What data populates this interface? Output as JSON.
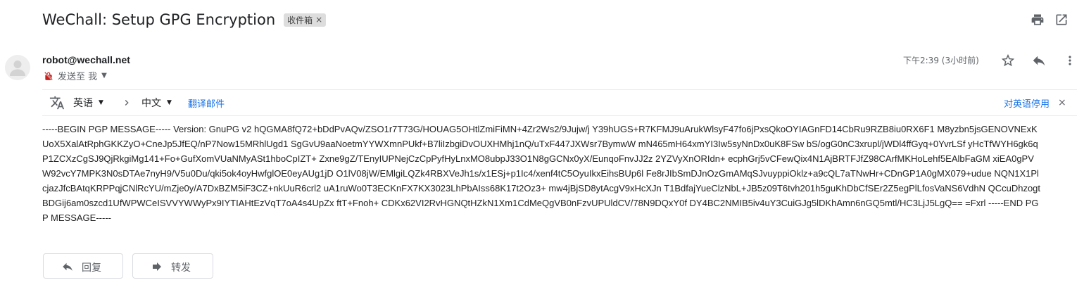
{
  "email": {
    "subject": "WeChall: Setup GPG Encryption",
    "label": "收件箱",
    "label_remove": "×",
    "sender": "robot@wechall.net",
    "to_text": "发送至 我",
    "timestamp": "下午2:39 (3小时前)",
    "body": "-----BEGIN PGP MESSAGE----- Version: GnuPG v2 hQGMA8fQ72+bDdPvAQv/ZSO1r7T73G/HOUAG5OHtlZmiFiMN+4Zr2Ws2/9Jujw/j Y39hUGS+R7KFMJ9uArukWlsyF47fo6jPxsQkoOYIAGnFD14CbRu9RZB8iu0RX6F1 M8yzbn5jsGENOVNExKUoX5XalAtRphGKKZyO+CneJp5JfEQ/nP7Now15MRhlUgd1 SgGvU9aaNoetmYYWXmnPUkf+B7liIzbgiDvOUXHMhj1nQ/uTxF447JXWsr7BymwW mN465mH64xmYI3Iw5syNnDx0uK8FSw bS/ogG0nC3xrupl/jWDl4ffGyq+0YvrLSf yHcTfWYH6gk6qP1ZCXzCgSJ9QjRkgiMg141+Fo+GufXomVUaNMyASt1hboCpIZT+ Zxne9gZ/TEnyIUPNejCzCpPyfHyLnxMO8ubpJ33O1N8gGCNx0yX/EunqoFnvJJ2z 2YZVyXnORIdn+ ecphGrj5vCFewQix4N1AjBRTFJfZ98CArfMKHoLehf5EAlbFaGM xiEA0gPVW92vcY7MPK3N0sDTAe7nyH9/V5u0Du/qki5ok4oyHwfglOE0eyAUg1jD O1lV08jW/EMlgiLQZk4RBXVeJh1s/x1ESj+p1Ic4/xenf4tC5OyuIkxEihsBUp6l Fe8rJIbSmDJnOzGmAMqSJvuyppiOklz+a9cQL7aTNwHr+CDnGP1A0gMX079+udue NQN1X1PlcjazJfcBAtqKRPPqjCNlRcYU/mZje0y/A7DxBZM5iF3CZ+nkUuR6crl2 uA1ruWo0T3ECKnFX7KX3023LhPbAIss68K17t2Oz3+ mw4jBjSD8ytAcgV9xHcXJn T1BdfajYueClzNbL+JB5z09T6tvh201h5guKhDbCfSEr2Z5egPlLfosVaNS6VdhN QCcuDhzogtBDGij6am0szcd1UfWPWCeISVVYWWyPx9IYTIAHtEzVqT7oA4s4UpZx ftT+Fnoh+ CDKx62VI2RvHGNQtHZkN1Xm1CdMeQgVB0nFzvUPUldCV/78N9DQxY0f DY4BC2NMIB5iv4uY3CuiGJg5lDKhAmn6nGQ5mtl/HC3LjJ5LgQ== =Fxrl -----END PGP MESSAGE-----"
  },
  "translate": {
    "source_lang": "英语",
    "target_lang": "中文",
    "translate_link": "翻译邮件",
    "stop_link": "对英语停用",
    "close": "×"
  },
  "actions": {
    "reply_label": "回复",
    "forward_label": "转发"
  },
  "icons": {
    "print": "print-icon",
    "open_new_window": "open-in-new-window-icon",
    "star": "star-icon",
    "reply": "reply-icon",
    "more": "more-vertical-icon",
    "translate": "translate-icon",
    "arrow": "chevron-right-icon",
    "avatar": "person-avatar-icon",
    "no_encryption": "no-encryption-icon",
    "forward": "forward-icon"
  },
  "colors": {
    "link": "#1a73e8",
    "text": "#202124",
    "muted": "#5f6368",
    "chip_bg": "#dddddd",
    "encryption_warning": "#c5221f"
  }
}
